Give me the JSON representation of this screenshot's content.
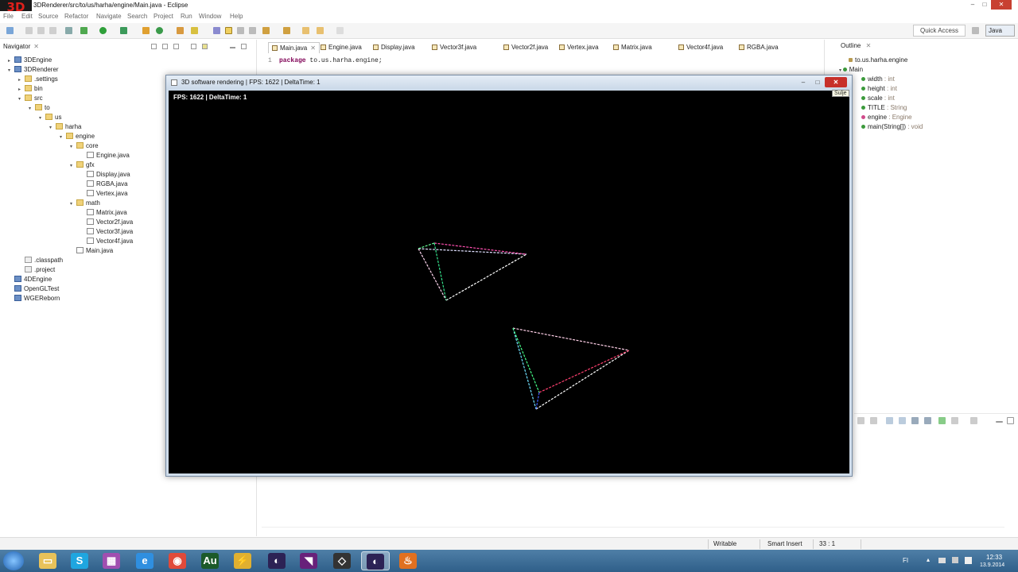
{
  "eclipse": {
    "title": "3DRenderer/src/to/us/harha/engine/Main.java - Eclipse",
    "logo_text": "3D",
    "controls": {
      "minimize": "–",
      "maximize": "□",
      "close": "✕"
    }
  },
  "menu": [
    "File",
    "Edit",
    "Source",
    "Refactor",
    "Navigate",
    "Search",
    "Project",
    "Run",
    "Window",
    "Help"
  ],
  "toolbar": {
    "quick_access": "Quick Access",
    "perspective": "Java"
  },
  "navigator": {
    "title": "Navigator",
    "close": "✕",
    "items": [
      {
        "label": "3DEngine",
        "type": "project",
        "depth": 0,
        "twisty": "▸"
      },
      {
        "label": "3DRenderer",
        "type": "project",
        "depth": 0,
        "twisty": "▾"
      },
      {
        "label": ".settings",
        "type": "folder",
        "depth": 1,
        "twisty": "▸"
      },
      {
        "label": "bin",
        "type": "folder",
        "depth": 1,
        "twisty": "▸"
      },
      {
        "label": "src",
        "type": "folder",
        "depth": 1,
        "twisty": "▾"
      },
      {
        "label": "to",
        "type": "folder",
        "depth": 2,
        "twisty": "▾"
      },
      {
        "label": "us",
        "type": "folder",
        "depth": 3,
        "twisty": "▾"
      },
      {
        "label": "harha",
        "type": "folder",
        "depth": 4,
        "twisty": "▾"
      },
      {
        "label": "engine",
        "type": "folder",
        "depth": 5,
        "twisty": "▾"
      },
      {
        "label": "core",
        "type": "folder",
        "depth": 6,
        "twisty": "▾"
      },
      {
        "label": "Engine.java",
        "type": "file",
        "depth": 7,
        "twisty": ""
      },
      {
        "label": "gfx",
        "type": "folder",
        "depth": 6,
        "twisty": "▾"
      },
      {
        "label": "Display.java",
        "type": "file",
        "depth": 7,
        "twisty": ""
      },
      {
        "label": "RGBA.java",
        "type": "file",
        "depth": 7,
        "twisty": ""
      },
      {
        "label": "Vertex.java",
        "type": "file",
        "depth": 7,
        "twisty": ""
      },
      {
        "label": "math",
        "type": "folder",
        "depth": 6,
        "twisty": "▾"
      },
      {
        "label": "Matrix.java",
        "type": "file",
        "depth": 7,
        "twisty": ""
      },
      {
        "label": "Vector2f.java",
        "type": "file",
        "depth": 7,
        "twisty": ""
      },
      {
        "label": "Vector3f.java",
        "type": "file",
        "depth": 7,
        "twisty": ""
      },
      {
        "label": "Vector4f.java",
        "type": "file",
        "depth": 7,
        "twisty": ""
      },
      {
        "label": "Main.java",
        "type": "file",
        "depth": 6,
        "twisty": ""
      },
      {
        "label": ".classpath",
        "type": "config",
        "depth": 1,
        "twisty": ""
      },
      {
        "label": ".project",
        "type": "config",
        "depth": 1,
        "twisty": ""
      },
      {
        "label": "4DEngine",
        "type": "project",
        "depth": 0,
        "twisty": ""
      },
      {
        "label": "OpenGLTest",
        "type": "project",
        "depth": 0,
        "twisty": ""
      },
      {
        "label": "WGEReborn",
        "type": "project",
        "depth": 0,
        "twisty": ""
      }
    ]
  },
  "editor": {
    "tabs": [
      {
        "label": "Main.java",
        "active": true,
        "close": "✕"
      },
      {
        "label": "Engine.java",
        "active": false
      },
      {
        "label": "Display.java",
        "active": false
      },
      {
        "label": "Vector3f.java",
        "active": false
      },
      {
        "label": "Vector2f.java",
        "active": false
      },
      {
        "label": "Vertex.java",
        "active": false
      },
      {
        "label": "Matrix.java",
        "active": false
      },
      {
        "label": "Vector4f.java",
        "active": false
      },
      {
        "label": "RGBA.java",
        "active": false
      }
    ],
    "line_number": "1",
    "code_keyword": "package",
    "code_rest": " to.us.harha.engine;"
  },
  "outline": {
    "title": "Outline",
    "close": "✕",
    "package": "to.us.harha.engine",
    "class": "Main",
    "members": [
      {
        "name": "width",
        "type": " : int",
        "color": "#3c9a3c"
      },
      {
        "name": "height",
        "type": " : int",
        "color": "#3c9a3c"
      },
      {
        "name": "scale",
        "type": " : int",
        "color": "#3c9a3c"
      },
      {
        "name": "TITLE",
        "type": " : String",
        "color": "#3c9a3c"
      },
      {
        "name": "engine",
        "type": " : Engine",
        "color": "#d04a8a"
      },
      {
        "name": "main(String[])",
        "type": " : void",
        "color": "#3c9a3c"
      }
    ]
  },
  "status": {
    "writable": "Writable",
    "insert_mode": "Smart Insert",
    "position": "33 : 1"
  },
  "render_window": {
    "title": "3D software rendering | FPS: 1622 | DeltaTime: 1",
    "fps_text": "FPS: 1622 | DeltaTime: 1",
    "controls": {
      "minimize": "–",
      "maximize": "□",
      "close": "✕"
    },
    "close_tooltip": "Sulje"
  },
  "taskbar": {
    "apps": [
      {
        "name": "explorer",
        "glyph": "▭",
        "color": "#e8c25a"
      },
      {
        "name": "skype",
        "glyph": "S",
        "color": "#1fa6e0"
      },
      {
        "name": "winrar",
        "glyph": "▦",
        "color": "#a04fb0"
      },
      {
        "name": "internet-explorer",
        "glyph": "e",
        "color": "#2f8fe0"
      },
      {
        "name": "chrome",
        "glyph": "◉",
        "color": "#e04a3a"
      },
      {
        "name": "audition",
        "glyph": "Au",
        "color": "#1c5a2a"
      },
      {
        "name": "flashpoint",
        "glyph": "⚡",
        "color": "#e0b030"
      },
      {
        "name": "eclipse",
        "glyph": "◐",
        "color": "#2c2255"
      },
      {
        "name": "visual-studio",
        "glyph": "◥",
        "color": "#68217a"
      },
      {
        "name": "unity",
        "glyph": "◇",
        "color": "#333333"
      },
      {
        "name": "eclipse-running",
        "glyph": "◐",
        "color": "#2c2255"
      },
      {
        "name": "java",
        "glyph": "♨",
        "color": "#e07020"
      }
    ],
    "tray_lang": "FI",
    "time": "12:33",
    "date": "13.9.2014"
  },
  "colors": {
    "accent": "#6b8fc5",
    "close_red": "#c7302a",
    "canvas": "#000000"
  }
}
